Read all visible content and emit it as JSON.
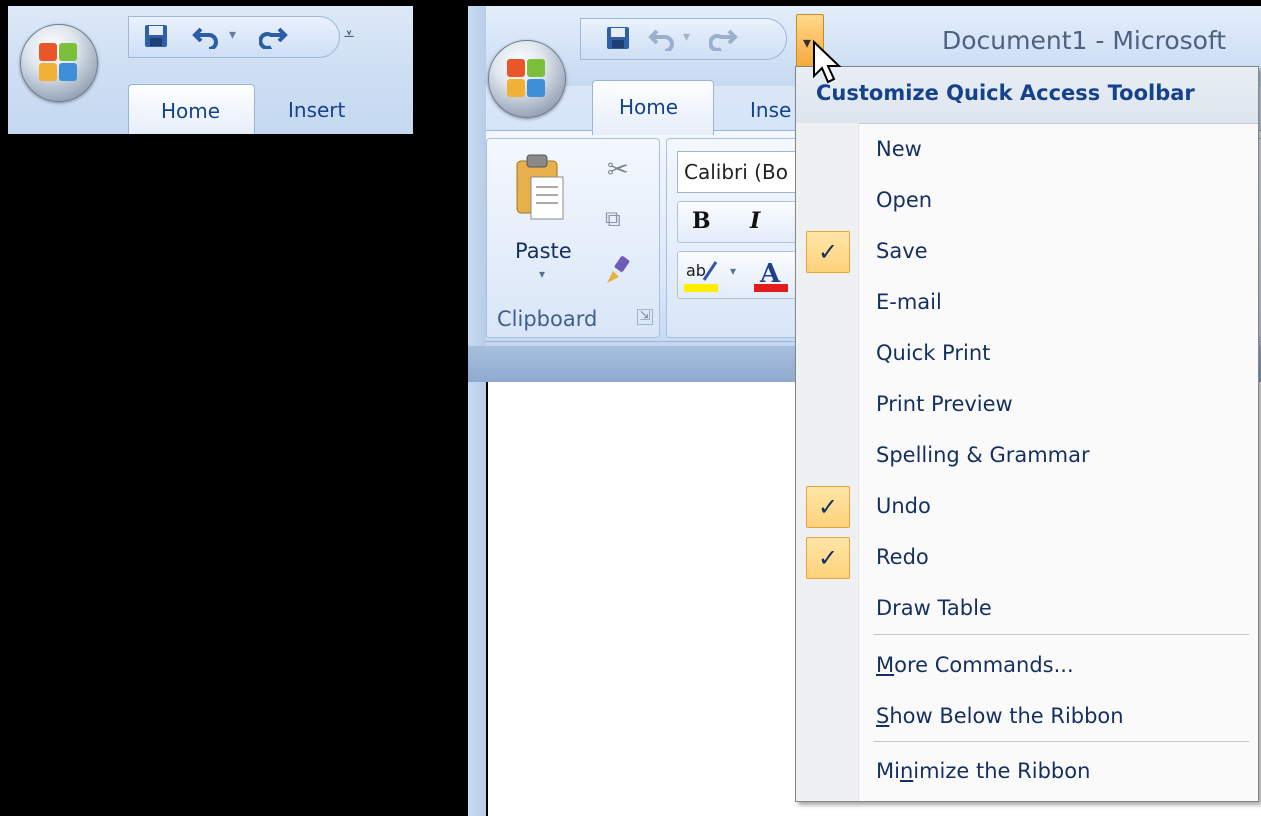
{
  "window": {
    "title": "Document1 - Microsoft"
  },
  "ribbon": {
    "tabs": [
      {
        "label": "Home"
      },
      {
        "label": "Insert"
      },
      {
        "label": "Inse"
      }
    ],
    "clipboard": {
      "paste_label": "Paste",
      "group_label": "Clipboard"
    },
    "font": {
      "font_name": "Calibri (Bo",
      "bold": "B",
      "italic": "I"
    }
  },
  "qat_menu": {
    "header": "Customize Quick Access Toolbar",
    "items": [
      {
        "label": "New",
        "checked": false
      },
      {
        "label": "Open",
        "checked": false
      },
      {
        "label": "Save",
        "checked": true
      },
      {
        "label": "E-mail",
        "checked": false
      },
      {
        "label": "Quick Print",
        "checked": false
      },
      {
        "label": "Print Preview",
        "checked": false
      },
      {
        "label": "Spelling & Grammar",
        "checked": false
      },
      {
        "label": "Undo",
        "checked": true
      },
      {
        "label": "Redo",
        "checked": true
      },
      {
        "label": "Draw Table",
        "checked": false
      }
    ],
    "more_commands": {
      "mnemonic": "M",
      "rest": "ore Commands..."
    },
    "show_below": {
      "mnemonic": "S",
      "rest": "how Below the Ribbon"
    },
    "minimize": {
      "pre": "Mi",
      "mnemonic": "n",
      "rest": "imize the Ribbon"
    },
    "check_glyph": "✓"
  },
  "colors": {
    "accent": "#15428b",
    "check_bg": "#ffd27a",
    "check_border": "#e3a33c"
  },
  "icons": [
    "office-button-icon",
    "save-icon",
    "undo-icon",
    "redo-icon",
    "customize-dropdown-icon",
    "paste-icon",
    "cut-icon",
    "copy-icon",
    "format-painter-icon",
    "highlight-icon",
    "font-color-icon",
    "dialog-launcher-icon",
    "mouse-cursor-icon"
  ]
}
